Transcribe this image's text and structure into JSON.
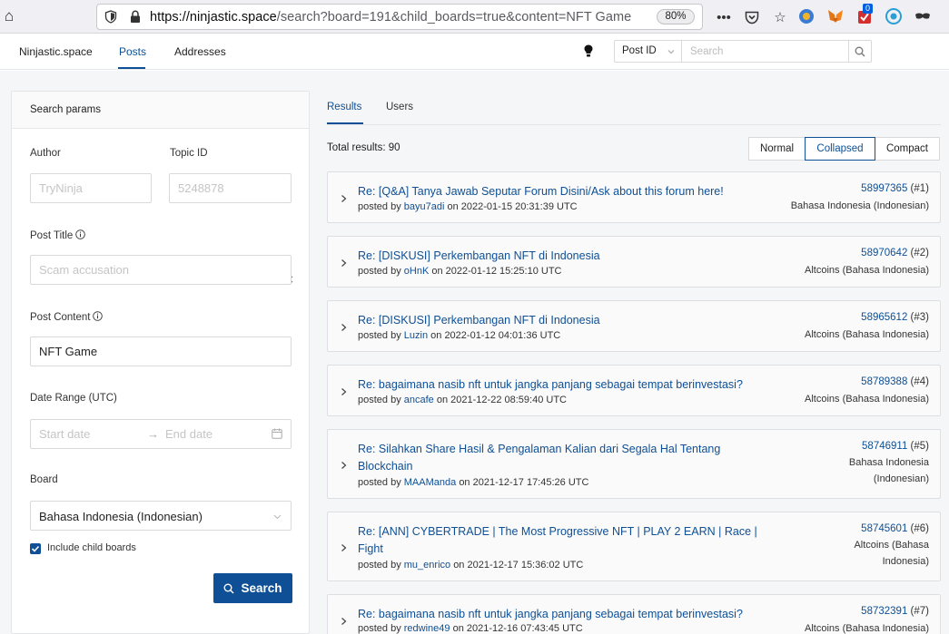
{
  "browser": {
    "url_host": "https://ninjastic.space",
    "url_rest": "/search?board=191&child_boards=true&content=NFT Game",
    "zoom": "80%",
    "ext_badge": "0"
  },
  "header": {
    "brand": "Ninjastic.space",
    "nav_posts": "Posts",
    "nav_addresses": "Addresses",
    "search_type": "Post ID",
    "search_placeholder": "Search"
  },
  "params": {
    "title": "Search params",
    "author_label": "Author",
    "author_placeholder": "TryNinja",
    "topic_label": "Topic ID",
    "topic_placeholder": "5248878",
    "post_title_label": "Post Title",
    "post_title_placeholder": "Scam accusation",
    "post_content_label": "Post Content",
    "post_content_value": "NFT Game",
    "date_label": "Date Range (UTC)",
    "start_placeholder": "Start date",
    "end_placeholder": "End date",
    "board_label": "Board",
    "board_value": "Bahasa Indonesia (Indonesian)",
    "child_boards_label": "Include child boards",
    "child_boards_checked": true,
    "search_button": "Search"
  },
  "results": {
    "tab_results": "Results",
    "tab_users": "Users",
    "total": "Total results: 90",
    "views": [
      "Normal",
      "Collapsed",
      "Compact"
    ],
    "active_view": "Collapsed",
    "posted_by": "posted by",
    "on": "on",
    "posts": [
      {
        "title": "Re: [Q&A] Tanya Jawab Seputar Forum Disini/Ask about this forum here!",
        "author": "bayu7adi",
        "date": "2022-01-15 20:31:39 UTC",
        "id": "58997365",
        "num": "(#1)",
        "board": "Bahasa Indonesia (Indonesian)"
      },
      {
        "title": "Re: [DISKUSI] Perkembangan NFT di Indonesia",
        "author": "oHnK",
        "date": "2022-01-12 15:25:10 UTC",
        "id": "58970642",
        "num": "(#2)",
        "board": "Altcoins (Bahasa Indonesia)"
      },
      {
        "title": "Re: [DISKUSI] Perkembangan NFT di Indonesia",
        "author": "Luzin",
        "date": "2022-01-12 04:01:36 UTC",
        "id": "58965612",
        "num": "(#3)",
        "board": "Altcoins (Bahasa Indonesia)"
      },
      {
        "title": "Re: bagaimana nasib nft untuk jangka panjang sebagai tempat berinvestasi?",
        "author": "ancafe",
        "date": "2021-12-22 08:59:40 UTC",
        "id": "58789388",
        "num": "(#4)",
        "board": "Altcoins (Bahasa Indonesia)"
      },
      {
        "title": "Re: Silahkan Share Hasil & Pengalaman Kalian dari Segala Hal Tentang Blockchain",
        "author": "MAAManda",
        "date": "2021-12-17 17:45:26 UTC",
        "id": "58746911",
        "num": "(#5)",
        "board": "Bahasa Indonesia (Indonesian)"
      },
      {
        "title": "Re: [ANN] CYBERTRADE | The Most Progressive NFT | PLAY 2 EARN | Race | Fight",
        "author": "mu_enrico",
        "date": "2021-12-17 15:36:02 UTC",
        "id": "58745601",
        "num": "(#6)",
        "board": "Altcoins (Bahasa Indonesia)"
      },
      {
        "title": "Re: bagaimana nasib nft untuk jangka panjang sebagai tempat berinvestasi?",
        "author": "redwine49",
        "date": "2021-12-16 07:43:45 UTC",
        "id": "58732391",
        "num": "(#7)",
        "board": "Altcoins (Bahasa Indonesia)"
      }
    ]
  },
  "colors": {
    "primary": "#0e4f95",
    "page_bg": "#f5f6f7",
    "border": "#dcdfe3"
  }
}
